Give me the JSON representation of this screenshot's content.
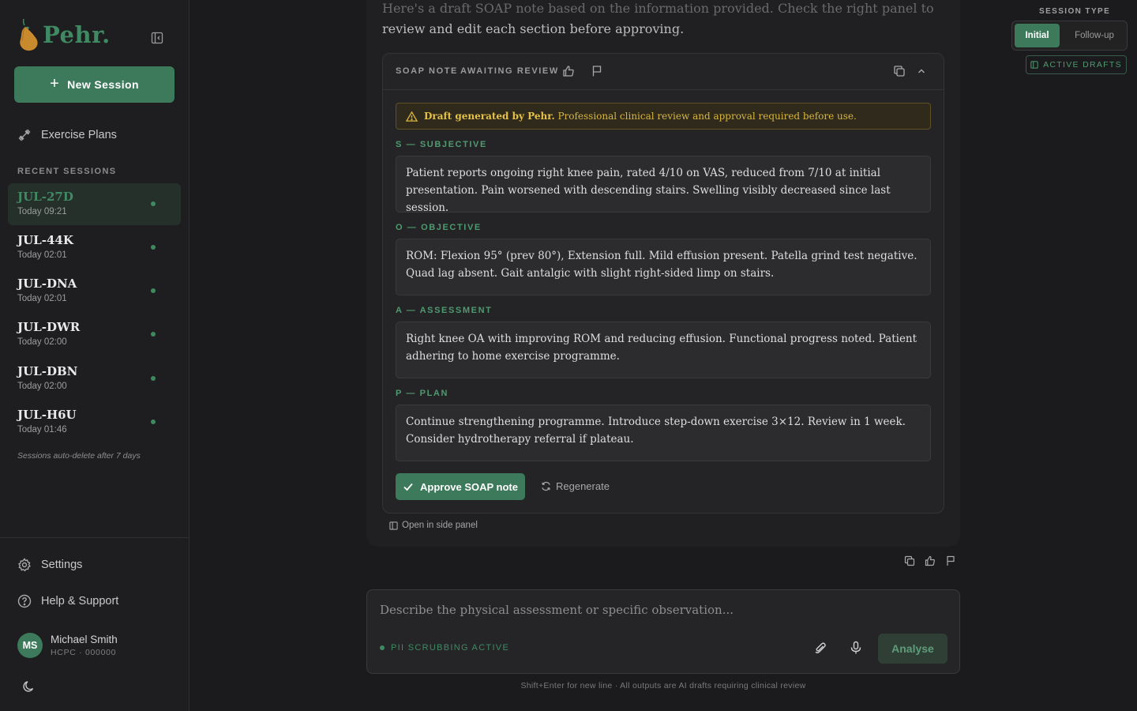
{
  "brand": {
    "name": "Pehr."
  },
  "sidebar": {
    "new_session_label": "New Session",
    "exercise_plans_label": "Exercise Plans",
    "recent_label": "RECENT SESSIONS",
    "sessions": [
      {
        "id": "JUL-27D",
        "time": "Today 09:21",
        "active": true
      },
      {
        "id": "JUL-44K",
        "time": "Today 02:01",
        "active": false
      },
      {
        "id": "JUL-DNA",
        "time": "Today 02:01",
        "active": false
      },
      {
        "id": "JUL-DWR",
        "time": "Today 02:00",
        "active": false
      },
      {
        "id": "JUL-DBN",
        "time": "Today 02:00",
        "active": false
      },
      {
        "id": "JUL-H6U",
        "time": "Today 01:46",
        "active": false
      }
    ],
    "autodelete_note": "Sessions auto-delete after 7 days",
    "settings_label": "Settings",
    "help_label": "Help & Support",
    "user": {
      "initials": "MS",
      "name": "Michael Smith",
      "sub": "HCPC · 000000"
    }
  },
  "message": {
    "intro_faded": "Here's a draft SOAP note based on the information provided. Check the right panel to",
    "intro_rest": "review and edit each section before approving."
  },
  "soap": {
    "title": "SOAP NOTE",
    "status": "AWAITING REVIEW",
    "warning_bold": "Draft generated by Pehr.",
    "warning_text": " Professional clinical review and approval required before use.",
    "sections": [
      {
        "label": "S — SUBJECTIVE",
        "text": "Patient reports ongoing right knee pain, rated 4/10 on VAS, reduced from 7/10 at initial presentation. Pain worsened with descending stairs. Swelling visibly decreased since last session."
      },
      {
        "label": "O — OBJECTIVE",
        "text": "ROM: Flexion 95° (prev 80°), Extension full. Mild effusion present. Patella grind test negative. Quad lag absent. Gait antalgic with slight right-sided limp on stairs."
      },
      {
        "label": "A — ASSESSMENT",
        "text": "Right knee OA with improving ROM and reducing effusion. Functional progress noted. Patient adhering to home exercise programme."
      },
      {
        "label": "P — PLAN",
        "text": "Continue strengthening programme. Introduce step-down exercise 3×12. Review in 1 week. Consider hydrotherapy referral if plateau."
      }
    ],
    "approve_label": "Approve SOAP note",
    "regenerate_label": "Regenerate",
    "open_side_label": "Open in side panel"
  },
  "composer": {
    "placeholder": "Describe the physical assessment or specific observation...",
    "pii_label": "PII SCRUBBING ACTIVE",
    "analyse_label": "Analyse",
    "footnote": "Shift+Enter for new line · All outputs are AI drafts requiring clinical review"
  },
  "session_type": {
    "label": "SESSION TYPE",
    "options": [
      "Initial",
      "Follow-up"
    ],
    "selected": "Initial",
    "active_drafts_label": "ACTIVE DRAFTS"
  },
  "colors": {
    "accent": "#3d7a5b",
    "accent_text": "#3f8a63",
    "warning": "#d9b53f",
    "background": "#1b1b1d"
  }
}
